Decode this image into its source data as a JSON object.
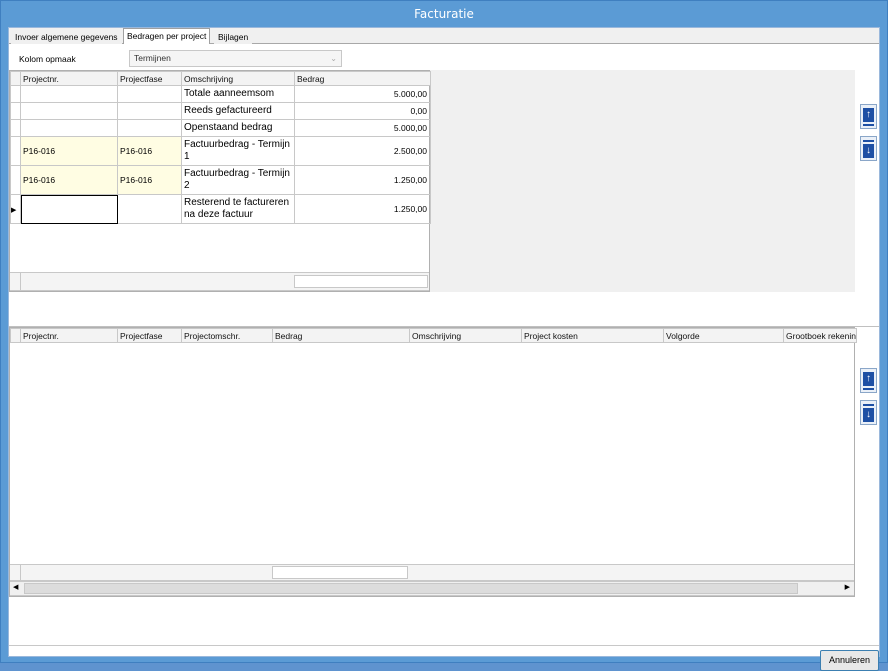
{
  "window": {
    "title": "Facturatie"
  },
  "tabs": [
    {
      "label": "Invoer algemene gegevens"
    },
    {
      "label": "Bedragen per project"
    },
    {
      "label": "Bijlagen"
    }
  ],
  "kolom": {
    "label": "Kolom opmaak",
    "value": "Termijnen"
  },
  "top_grid": {
    "headers": [
      "Projectnr.",
      "Projectfase",
      "Omschrijving",
      "Bedrag"
    ],
    "rows": [
      {
        "projectnr": "",
        "fase": "",
        "omschrijving": "Totale aanneemsom",
        "bedrag": "5.000,00"
      },
      {
        "projectnr": "",
        "fase": "",
        "omschrijving": "Reeds gefactureerd",
        "bedrag": "0,00"
      },
      {
        "projectnr": "",
        "fase": "",
        "omschrijving": "Openstaand bedrag",
        "bedrag": "5.000,00"
      },
      {
        "projectnr": "P16-016",
        "fase": "P16-016",
        "omschrijving": "Factuurbedrag - Termijn 1",
        "bedrag": "2.500,00"
      },
      {
        "projectnr": "P16-016",
        "fase": "P16-016",
        "omschrijving": "Factuurbedrag - Termijn 2",
        "bedrag": "1.250,00"
      },
      {
        "projectnr": "",
        "fase": "",
        "omschrijving": "Resterend te factureren na deze factuur",
        "bedrag": "1.250,00"
      }
    ]
  },
  "bottom_grid": {
    "headers": [
      "Projectnr.",
      "Projectfase",
      "Projectomschr.",
      "Bedrag",
      "Omschrijving",
      "Project kosten",
      "Volgorde",
      "Grootboek rekenin"
    ]
  },
  "buttons": {
    "annuleren": "Annuleren"
  },
  "icons": {
    "up": "move-up-icon",
    "down": "move-down-icon"
  }
}
